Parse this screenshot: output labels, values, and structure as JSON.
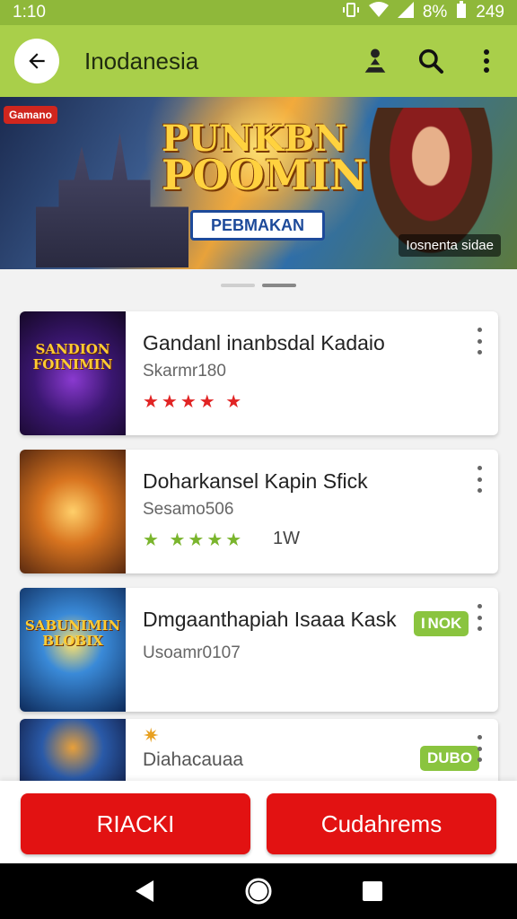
{
  "status": {
    "time": "1:10",
    "battery": "8%",
    "right_time": "249"
  },
  "header": {
    "title": "Inodanesia"
  },
  "banner": {
    "badge": "Gamano",
    "title_line1": "PUNKBN",
    "title_line2": "POOMIN",
    "subtitle": "PEBMAKAN",
    "tag": "Iosnenta sidae"
  },
  "list": [
    {
      "thumb_text": "SANDION FOINIMIN",
      "title": "Gandanl inanbsdal Kadaio",
      "subtitle": "Skarmr180",
      "stars": "★★★★ ★",
      "extra": "",
      "badge": ""
    },
    {
      "thumb_text": "",
      "title": "Doharkansel Kapin Sfick",
      "subtitle": "Sesamo506",
      "stars": "★ ★★★★",
      "extra": "1W",
      "badge": ""
    },
    {
      "thumb_text": "SABUNIMIN BLOBIX",
      "title": "Dmgaanthapiah Isaaa Kask",
      "subtitle": "Usoamr0107",
      "stars": "",
      "extra": "",
      "badge": "I NOK"
    },
    {
      "thumb_text": "",
      "title": "",
      "subtitle": "Diahacauaa",
      "stars": "",
      "extra": "",
      "badge": "DUBO"
    }
  ],
  "actions": {
    "left": "RIACKI",
    "right": "Cudahrems"
  },
  "colors": {
    "appbar": "#a9cf4a",
    "accent_red": "#e21212",
    "badge_green": "#8ac43f"
  }
}
